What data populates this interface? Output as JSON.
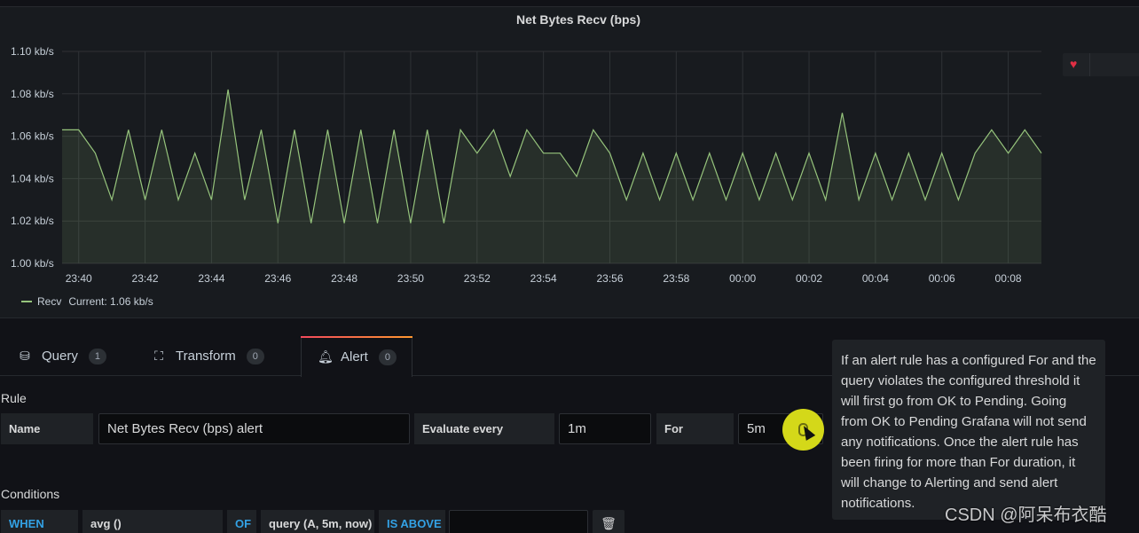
{
  "panel": {
    "title": "Net Bytes Recv (bps)"
  },
  "chart_data": {
    "type": "line",
    "title": "Net Bytes Recv (bps)",
    "y_ticks": [
      "1.00 kb/s",
      "1.02 kb/s",
      "1.04 kb/s",
      "1.06 kb/s",
      "1.08 kb/s",
      "1.10 kb/s"
    ],
    "ylim": [
      1.0,
      1.1
    ],
    "x_ticks": [
      "23:40",
      "23:42",
      "23:44",
      "23:46",
      "23:48",
      "23:50",
      "23:52",
      "23:54",
      "23:56",
      "23:58",
      "00:00",
      "00:02",
      "00:04",
      "00:06",
      "00:08"
    ],
    "x_minutes_start": "23:39.5",
    "grid": true,
    "series": [
      {
        "name": "Recv",
        "color": "#96c47c",
        "x": [
          "23:39.5",
          "23:40",
          "23:40.5",
          "23:41",
          "23:41.5",
          "23:42",
          "23:42.5",
          "23:43",
          "23:43.5",
          "23:44",
          "23:44.5",
          "23:45",
          "23:45.5",
          "23:46",
          "23:46.5",
          "23:47",
          "23:47.5",
          "23:48",
          "23:48.5",
          "23:49",
          "23:49.5",
          "23:50",
          "23:50.5",
          "23:51",
          "23:51.5",
          "23:52",
          "23:52.5",
          "23:53",
          "23:53.5",
          "23:54",
          "23:54.5",
          "23:55",
          "23:55.5",
          "23:56",
          "23:56.5",
          "23:57",
          "23:57.5",
          "23:58",
          "23:58.5",
          "23:59",
          "23:59.5",
          "00:00",
          "00:00.5",
          "00:01",
          "00:01.5",
          "00:02",
          "00:02.5",
          "00:03",
          "00:03.5",
          "00:04",
          "00:04.5",
          "00:05",
          "00:05.5",
          "00:06",
          "00:06.5",
          "00:07",
          "00:07.5",
          "00:08",
          "00:08.5",
          "00:09"
        ],
        "values": [
          1.063,
          1.063,
          1.052,
          1.03,
          1.063,
          1.03,
          1.063,
          1.03,
          1.052,
          1.03,
          1.082,
          1.03,
          1.063,
          1.019,
          1.063,
          1.019,
          1.063,
          1.019,
          1.063,
          1.019,
          1.063,
          1.019,
          1.063,
          1.019,
          1.063,
          1.052,
          1.063,
          1.041,
          1.063,
          1.052,
          1.052,
          1.041,
          1.063,
          1.052,
          1.03,
          1.052,
          1.03,
          1.052,
          1.03,
          1.052,
          1.03,
          1.052,
          1.03,
          1.052,
          1.03,
          1.052,
          1.03,
          1.071,
          1.03,
          1.052,
          1.03,
          1.052,
          1.03,
          1.052,
          1.03,
          1.052,
          1.063,
          1.052,
          1.063,
          1.052
        ]
      }
    ],
    "legend": {
      "placement": "bottom-left",
      "label": "Recv",
      "current": "Current: 1.06 kb/s"
    }
  },
  "tabs": [
    {
      "label": "Query",
      "count": "1",
      "icon": "database-icon"
    },
    {
      "label": "Transform",
      "count": "0",
      "icon": "transform-icon"
    },
    {
      "label": "Alert",
      "count": "0",
      "icon": "bell-icon"
    }
  ],
  "rule": {
    "section_title": "Rule",
    "name_label": "Name",
    "name_value": "Net Bytes Recv (bps) alert",
    "evaluate_label": "Evaluate every",
    "evaluate_value": "1m",
    "for_label": "For",
    "for_value": "5m"
  },
  "conditions": {
    "section_title": "Conditions",
    "when": "WHEN",
    "reducer": "avg ()",
    "of": "OF",
    "query": "query (A, 5m, now)",
    "evaluator": "IS ABOVE",
    "threshold": ""
  },
  "tooltip": {
    "text": "If an alert rule has a configured For and the query violates the configured threshold it will first go from OK to Pending. Going from OK to Pending Grafana will not send any notifications. Once the alert rule has been firing for more than For duration, it will change to Alerting and send alert notifications."
  },
  "watermark": "CSDN @阿呆布衣酷"
}
